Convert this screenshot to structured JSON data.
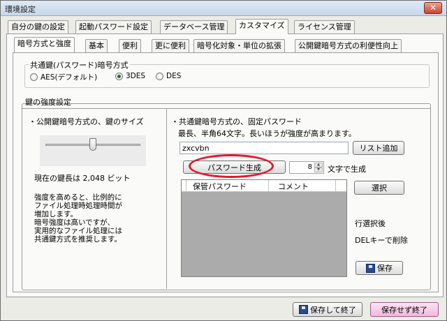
{
  "window": {
    "title": "環境設定"
  },
  "close_glyph": "✕",
  "main_tabs": [
    {
      "label": "自分の鍵の設定",
      "active": false
    },
    {
      "label": "起動パスワード設定",
      "active": false
    },
    {
      "label": "データベース管理",
      "active": false
    },
    {
      "label": "カスタマイズ",
      "active": true
    },
    {
      "label": "ライセンス管理",
      "active": false
    }
  ],
  "sub_tabs": [
    {
      "label": "暗号方式と強度",
      "active": true
    },
    {
      "label": "基本",
      "active": false
    },
    {
      "label": "便利",
      "active": false
    },
    {
      "label": "更に便利",
      "active": false
    },
    {
      "label": "暗号化対象・単位の拡張",
      "active": false
    },
    {
      "label": "公開鍵暗号方式の利便性向上",
      "active": false
    }
  ],
  "cipher_group": {
    "title": "共通鍵(パスワード)暗号方式",
    "options": [
      {
        "label": "AES(デフォルト)",
        "checked": false
      },
      {
        "label": "3DES",
        "checked": true
      },
      {
        "label": "DES",
        "checked": false
      }
    ]
  },
  "strength_group": {
    "title": "鍵の強度設定",
    "left": {
      "heading": "・公開鍵暗号方式の、鍵のサイズ",
      "key_length_text": "現在の鍵長は 2,048 ビット",
      "slider_level": 0.5,
      "description_lines": [
        "強度を高めると、比例的に",
        "ファイル処理時処理時間が",
        "増加します。",
        "暗号強度は高いですが、",
        "実用的なファイル処理には",
        "共通鍵方式を推奨します。"
      ]
    },
    "right": {
      "heading": "・共通鍵暗号方式の、固定パスワード",
      "subheading": "最長、半角64文字。長いほうが強度が高まります。",
      "password_value": "zxcvbn",
      "add_to_list_label": "リスト追加",
      "generate_label": "パスワード生成",
      "char_count": "8",
      "char_count_suffix": "文字で生成",
      "list_columns": [
        "保管パスワード",
        "コメント"
      ],
      "select_label": "選択",
      "hint_line1": "行選択後",
      "hint_line2": "DELキーで削除",
      "save_label": "保存",
      "spin_up": "▲",
      "spin_down": "▼"
    }
  },
  "footer": {
    "save_close_label": "保存して終了",
    "close_nosave_label": "保存せず終了"
  },
  "colors": {
    "annotation_oval": "#e3192b",
    "close_button": "#c8452e",
    "nosave_button": "#f3b8dd"
  }
}
